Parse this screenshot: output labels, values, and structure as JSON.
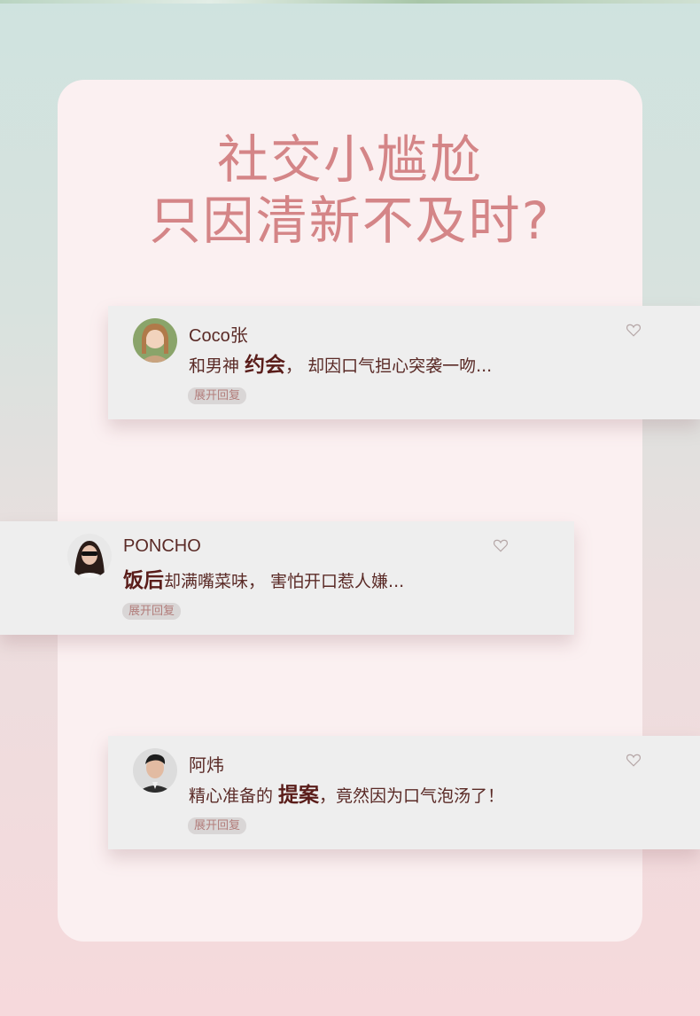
{
  "headline": {
    "line1": "社交小尴尬",
    "line2": "只因清新不及时?"
  },
  "comments": [
    {
      "user": "Coco张",
      "text_before": "和男神 ",
      "highlight": "约会",
      "text_after": "，  却因口气担心突袭一吻...",
      "reply_label": "展开回复"
    },
    {
      "user": "PONCHO",
      "text_before": "",
      "highlight": "饭后",
      "text_after": "却满嘴菜味，  害怕开口惹人嫌...",
      "reply_label": "展开回复"
    },
    {
      "user": "阿炜",
      "text_before": "精心准备的 ",
      "highlight": "提案",
      "text_after": "，竟然因为口气泡汤了！",
      "reply_label": "展开回复"
    }
  ],
  "icons": {
    "like": "heart-outline-icon"
  },
  "colors": {
    "headline": "#d48587",
    "panel": "#fbf0f1",
    "card": "#eeeeee",
    "text": "#5a2a26"
  }
}
